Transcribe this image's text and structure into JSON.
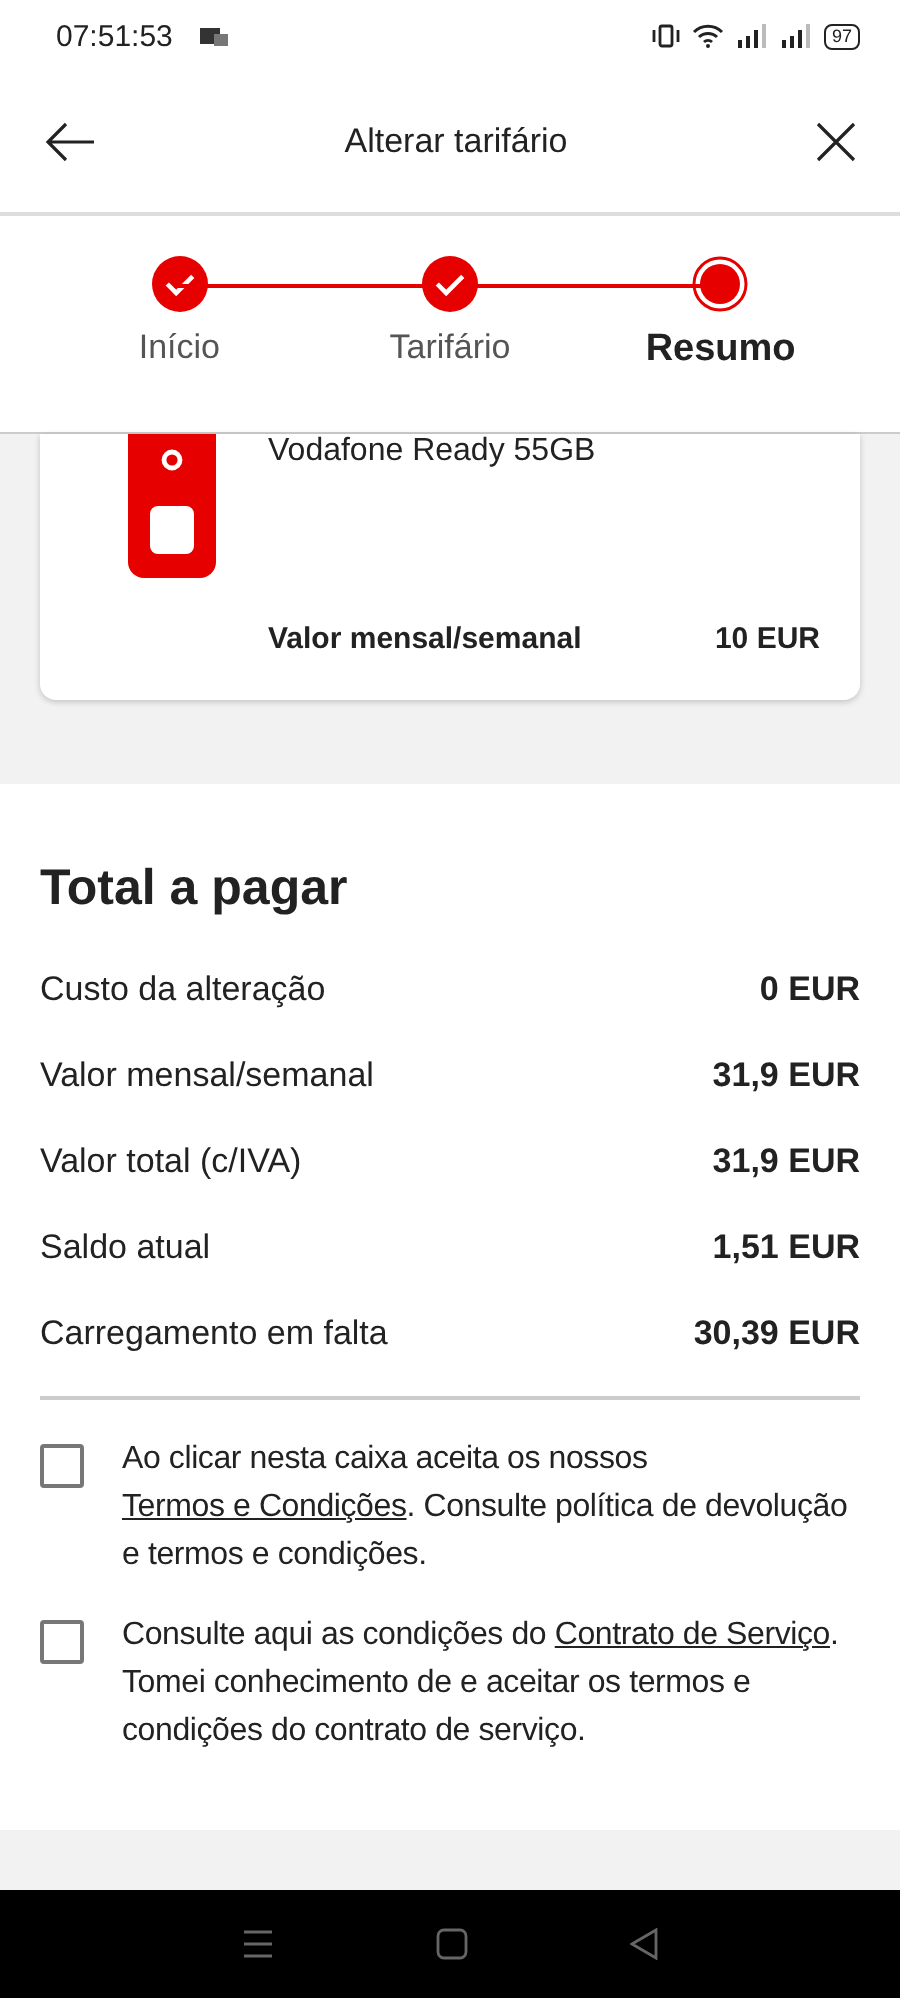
{
  "status_bar": {
    "time": "07:51:53",
    "battery": "97"
  },
  "header": {
    "title": "Alterar tarifário"
  },
  "steps": [
    {
      "label": "Início",
      "completed": true,
      "selected": false
    },
    {
      "label": "Tarifário",
      "completed": true,
      "selected": false
    },
    {
      "label": "Resumo",
      "completed": false,
      "selected": true
    }
  ],
  "plan_card": {
    "name": "Vodafone Ready 55GB",
    "price_label": "Valor mensal/semanal",
    "price": "10 EUR"
  },
  "total": {
    "title": "Total a pagar",
    "rows": [
      {
        "label": "Custo da alteração",
        "value": "0 EUR"
      },
      {
        "label": "Valor mensal/semanal",
        "value": "31,9 EUR"
      },
      {
        "label": "Valor total (c/IVA)",
        "value": "31,9 EUR"
      },
      {
        "label": "Saldo atual",
        "value": "1,51 EUR"
      },
      {
        "label": "Carregamento em falta",
        "value": "30,39 EUR"
      }
    ]
  },
  "agreements": [
    {
      "checked": false,
      "before": "Ao clicar nesta caixa aceita os nossos ",
      "link": "Termos e Condições",
      "after": ". Consulte política de devolução e termos e condições."
    },
    {
      "checked": false,
      "before": "Consulte aqui as condições do ",
      "link": "Contrato de Serviço",
      "after": ". Tomei conhecimento de e aceitar os termos e condições do contrato de serviço."
    }
  ]
}
